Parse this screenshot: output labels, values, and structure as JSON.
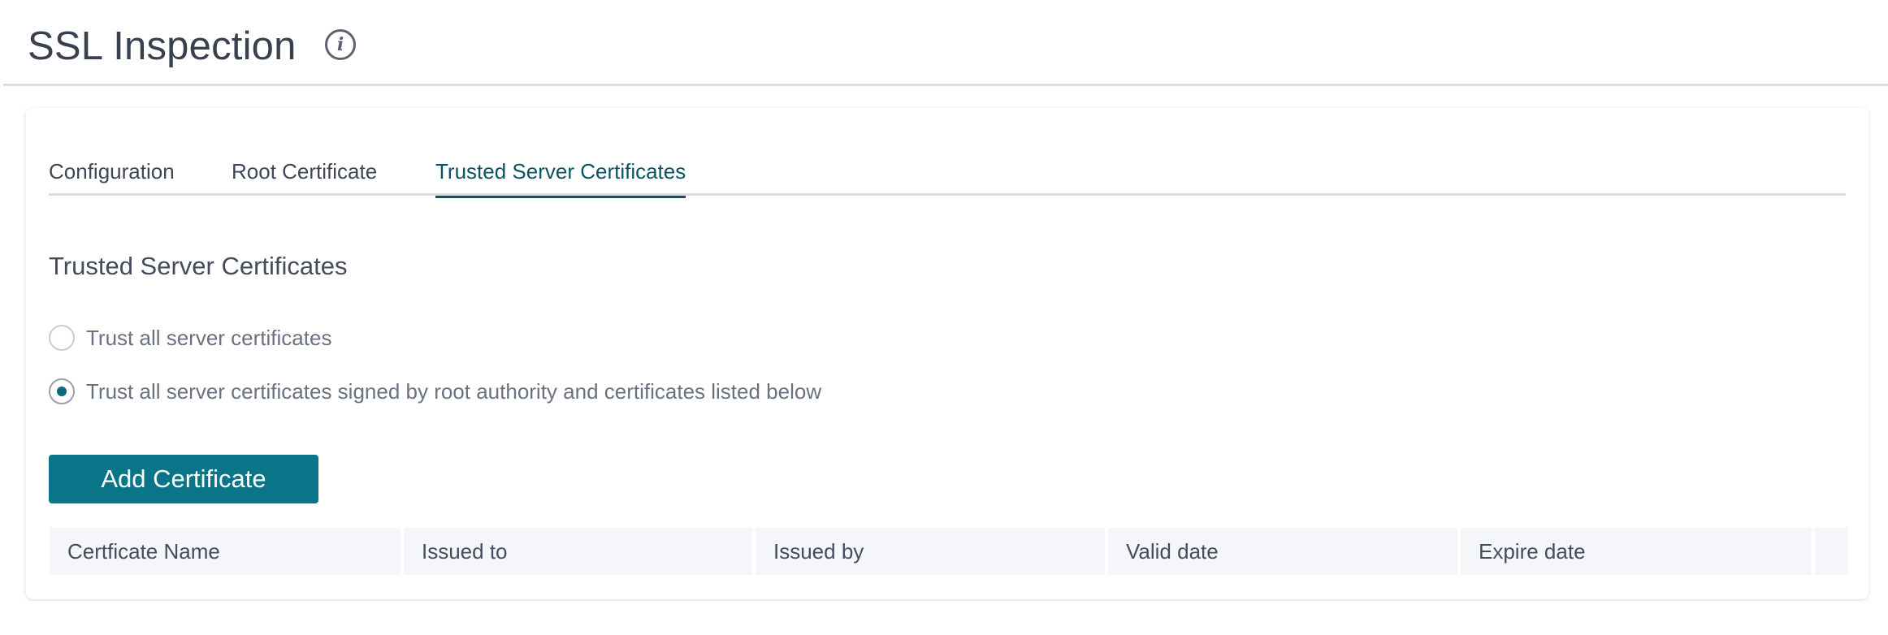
{
  "header": {
    "title": "SSL Inspection",
    "info_icon": "info-icon"
  },
  "tabs": [
    {
      "label": "Configuration",
      "active": false
    },
    {
      "label": "Root Certificate",
      "active": false
    },
    {
      "label": "Trusted Server Certificates",
      "active": true
    }
  ],
  "section": {
    "title": "Trusted Server Certificates",
    "options": [
      {
        "label": "Trust all server certificates",
        "selected": false
      },
      {
        "label": "Trust all server certificates signed by root authority and certificates listed below",
        "selected": true
      }
    ]
  },
  "actions": {
    "add_certificate_label": "Add Certificate"
  },
  "table": {
    "columns": [
      "Certficate Name",
      "Issued to",
      "Issued by",
      "Valid date",
      "Expire date",
      ""
    ],
    "rows": []
  },
  "colors": {
    "accent": "#0a7588",
    "active_tab": "#0b5563",
    "header_bg": "#f5f6fa",
    "text": "#39414f"
  }
}
